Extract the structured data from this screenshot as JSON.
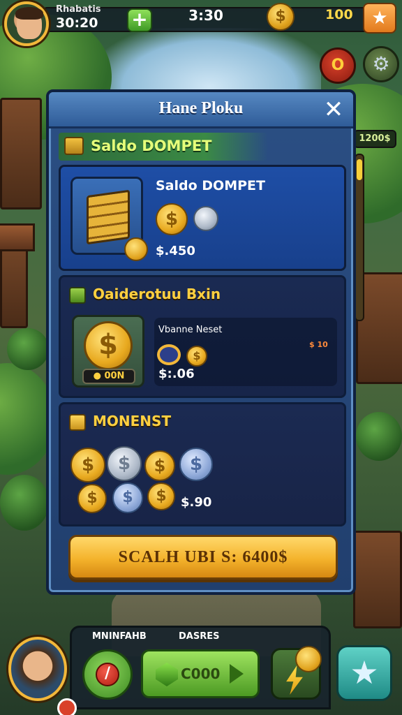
{
  "hud": {
    "player_name": "Rhabatis",
    "player_score": "30:20",
    "plus_icon": "+",
    "timer": "3:30",
    "coin_icon": "$",
    "coin_count": "100",
    "star_icon": "★",
    "side_red_icon": "O",
    "side_gear_icon": "⚙",
    "side_badge": "1200$"
  },
  "panel": {
    "title": "Hane Ploku",
    "close_icon": "✕",
    "ribbon_text": "Saldo DOMPET",
    "cards": [
      {
        "name": "Saldo DOMPET",
        "price": "$.450"
      },
      {
        "heading": "Oaiderotuu Bxin",
        "coin_tag": "● 00N",
        "big_coin_icon": "$",
        "info_label": "Vbanne Neset",
        "info_tag": "$ 10",
        "price": "$:.06"
      },
      {
        "heading": "MONENST",
        "price": "$.90"
      }
    ],
    "buy_label": "SCALH UBI S: 6400$"
  },
  "bottom": {
    "label_1": "MNINFAHB",
    "label_2": "DASRES",
    "play_label": "C000",
    "star_icon": "★",
    "stop_icon": "/"
  },
  "colors": {
    "panel": "#2b4f84",
    "gold": "#f4b32c",
    "green": "#4c9a23",
    "heading_gold": "#ffd040"
  }
}
